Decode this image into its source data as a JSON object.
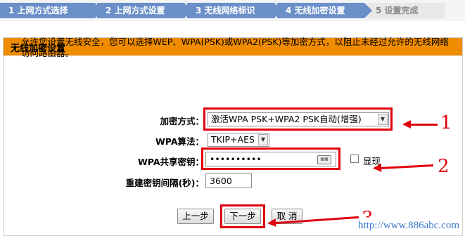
{
  "steps": [
    {
      "label": "1 上网方式选择"
    },
    {
      "label": "2 上网方式设置"
    },
    {
      "label": "3 无线网络标识"
    },
    {
      "label": "4 无线加密设置"
    },
    {
      "label": "5 设置完成"
    }
  ],
  "panel": {
    "title": "无线加密设置",
    "description": "允许您设置无线安全，您可以选择WEP、WPA(PSK)或WPA2(PSK)等加密方式，以阻止未经过允许的无线网络访问路由器。"
  },
  "form": {
    "encryption_label": "加密方式：",
    "encryption_value": "激活WPA PSK+WPA2 PSK自动(增强)",
    "algorithm_label": "WPA算法：",
    "algorithm_value": "TKIP+AES",
    "key_label": "WPA共享密钥：",
    "key_value": "••••••••••",
    "show_label": "显现",
    "rekey_label": "重建密钥间隔(秒)：",
    "rekey_value": "3600"
  },
  "buttons": {
    "prev": "上一步",
    "next": "下一步",
    "cancel": "取 消"
  },
  "annotations": {
    "marker1": "1",
    "marker2": "2",
    "marker3": "3"
  },
  "watermark": "http://www.886abc.com",
  "colors": {
    "step_active": "#6a8fc9",
    "panel_header": "#f08c00",
    "annotation_red": "#e0000b"
  }
}
